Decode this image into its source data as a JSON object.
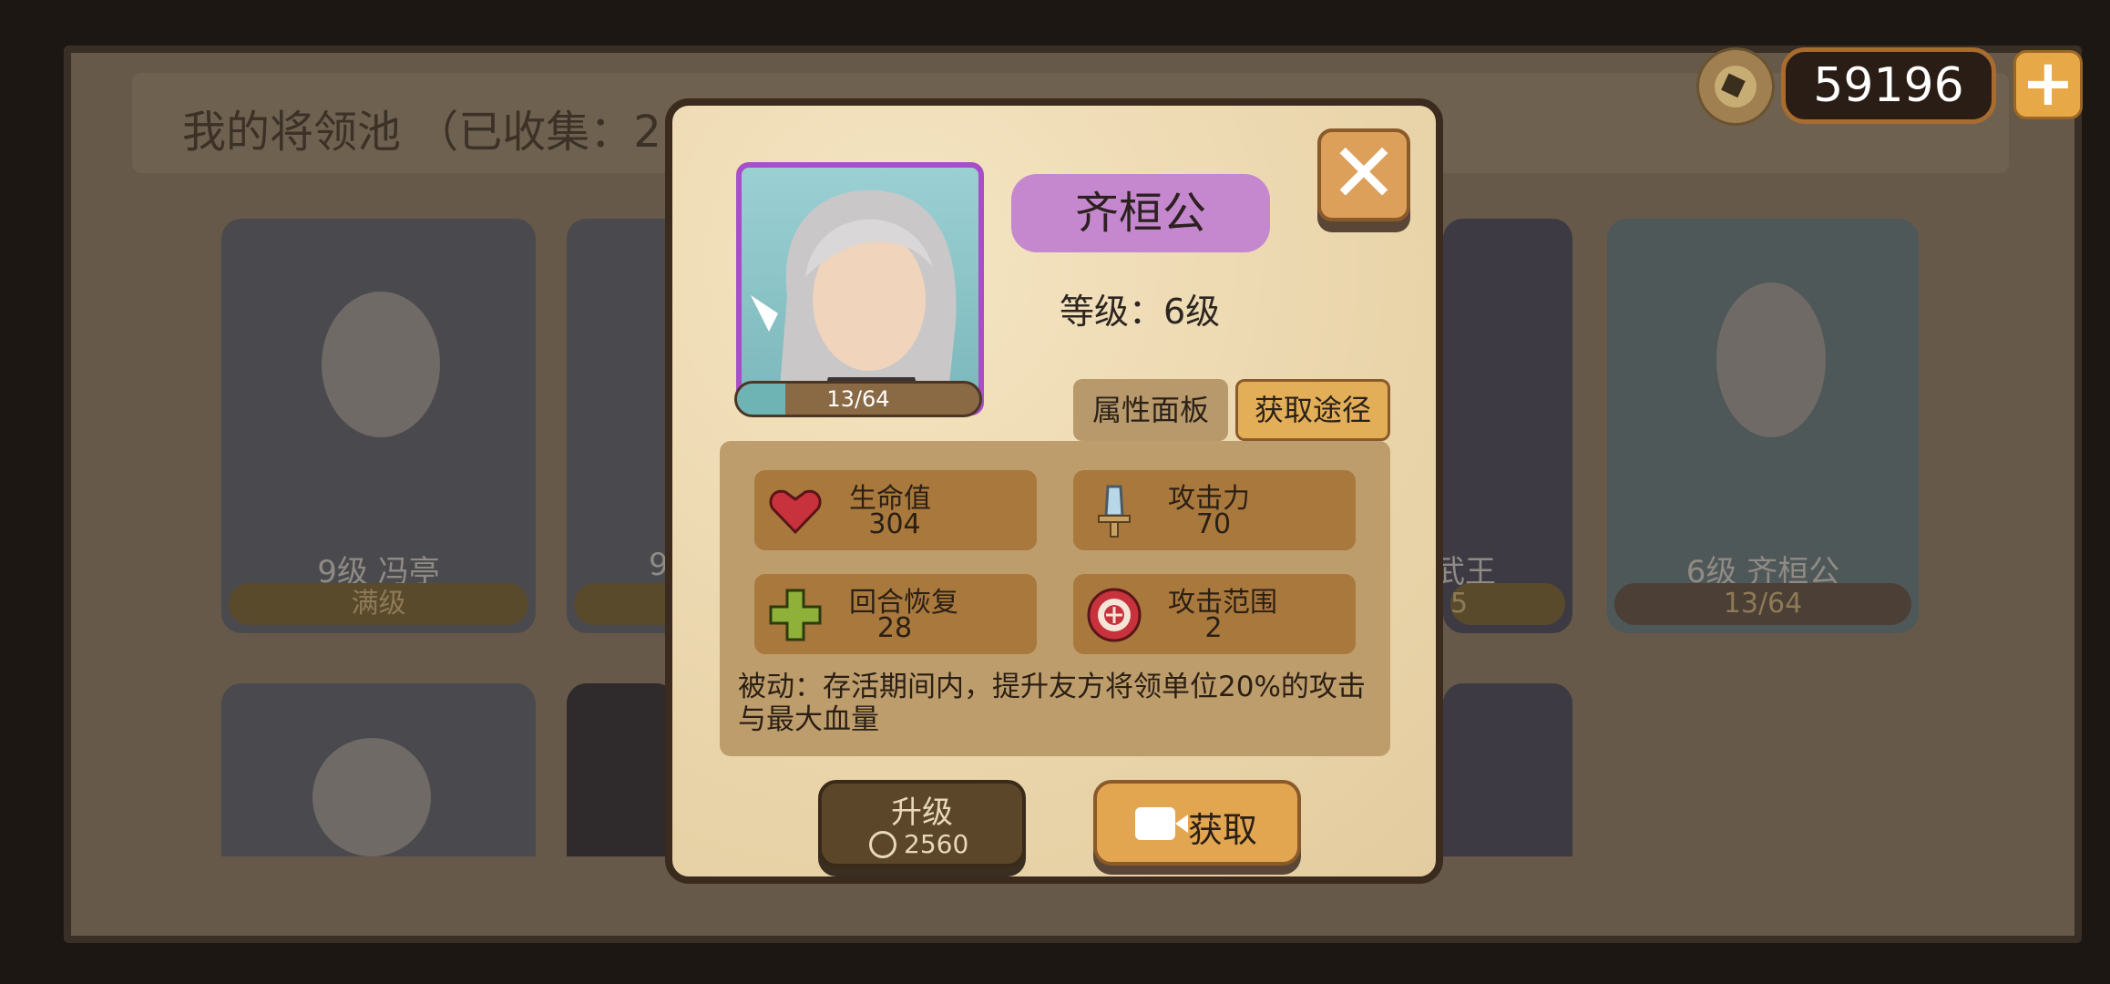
{
  "pool": {
    "title": "我的将领池 （已收集：2",
    "cards": [
      {
        "label": "9级  冯亭",
        "bar": "满级"
      },
      {
        "label": "9",
        "bar": ""
      },
      {
        "label": "武王",
        "bar": "5"
      },
      {
        "label": "6级 齐桓公",
        "bar": "13/64",
        "progress": 0.2
      }
    ]
  },
  "topbar": {
    "coins": "59196",
    "add_label": "+"
  },
  "dialog": {
    "general_name": "齐桓公",
    "level_text": "等级：6级",
    "xp_text": "13/64",
    "xp_progress": 0.2,
    "tabs": {
      "attributes": "属性面板",
      "obtain_methods": "获取途径"
    },
    "stats": [
      {
        "name": "生命值",
        "value": "304",
        "icon": "heart-icon"
      },
      {
        "name": "攻击力",
        "value": "70",
        "icon": "sword-icon"
      },
      {
        "name": "回合恢复",
        "value": "28",
        "icon": "plus-icon"
      },
      {
        "name": "攻击范围",
        "value": "2",
        "icon": "target-icon"
      }
    ],
    "passive": "被动：存活期间内，提升友方将领单位20%的攻击与最大血量",
    "upgrade": {
      "label": "升级",
      "cost": "2560"
    },
    "obtain": {
      "label": "获取"
    },
    "close_label": "✕"
  }
}
